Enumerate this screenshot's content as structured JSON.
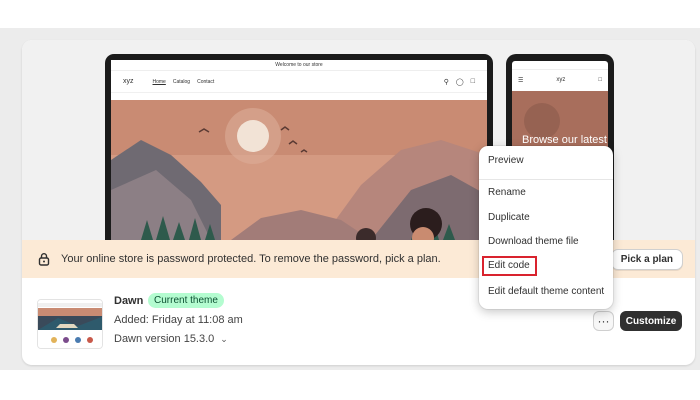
{
  "store_preview": {
    "announcement": "Welcome to our store",
    "logo": "xyz",
    "nav_links": [
      "Home",
      "Catalog",
      "Contact"
    ],
    "mobile_heading": "Browse our latest"
  },
  "banner": {
    "message": "Your online store is password protected. To remove the password, pick a plan.",
    "button_label": "Pick a plan",
    "icon": "lock-icon",
    "background_color": "#fcead6"
  },
  "theme": {
    "name": "Dawn",
    "badge": "Current theme",
    "badge_color": "#b4fcd0",
    "added": "Added: Friday at 11:08 am",
    "version": "Dawn version 15.3.0"
  },
  "actions": {
    "more_label": "···",
    "customize_label": "Customize"
  },
  "menu": {
    "items": [
      "Preview",
      "Rename",
      "Duplicate",
      "Download theme file",
      "Edit code",
      "Edit default theme content"
    ],
    "highlighted_item": "Edit code",
    "highlight_color": "#d9232e"
  }
}
